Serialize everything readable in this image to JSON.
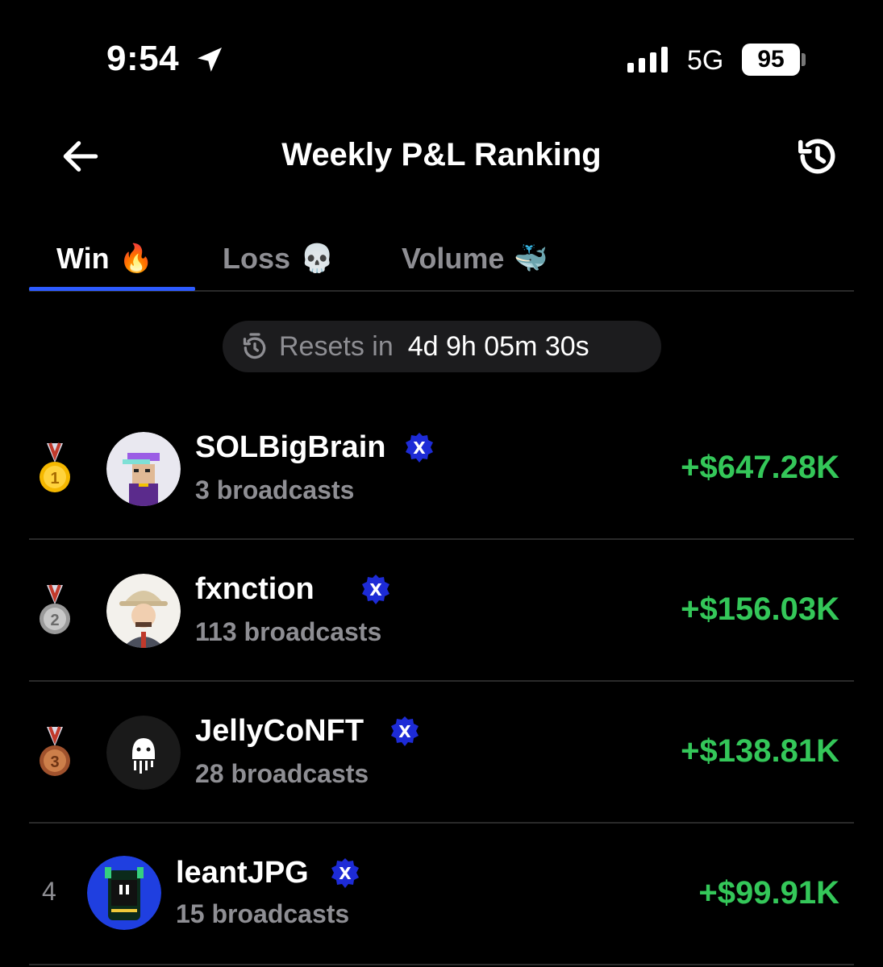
{
  "status_bar": {
    "time": "9:54",
    "network": "5G",
    "battery": "95"
  },
  "header": {
    "title": "Weekly P&L Ranking"
  },
  "tabs": [
    {
      "label": "Win",
      "emoji": "🔥",
      "active": true
    },
    {
      "label": "Loss",
      "emoji": "💀",
      "active": false
    },
    {
      "label": "Volume",
      "emoji": "🐳",
      "active": false
    }
  ],
  "reset": {
    "label": "Resets in",
    "value": "4d 9h 05m 30s"
  },
  "rankings": [
    {
      "rank": "1",
      "name": "SOLBigBrain",
      "broadcasts": "3 broadcasts",
      "pnl": "+$647.28K"
    },
    {
      "rank": "2",
      "name": "fxnction",
      "broadcasts": "113 broadcasts",
      "pnl": "+$156.03K"
    },
    {
      "rank": "3",
      "name": "JellyCoNFT",
      "broadcasts": "28 broadcasts",
      "pnl": "+$138.81K"
    },
    {
      "rank": "4",
      "name": "leantJPG",
      "broadcasts": "15 broadcasts",
      "pnl": "+$99.91K"
    }
  ],
  "colors": {
    "accent": "#2d5bff",
    "profit": "#34c759",
    "muted": "#8e8e93",
    "badge": "#1d2bd6"
  }
}
